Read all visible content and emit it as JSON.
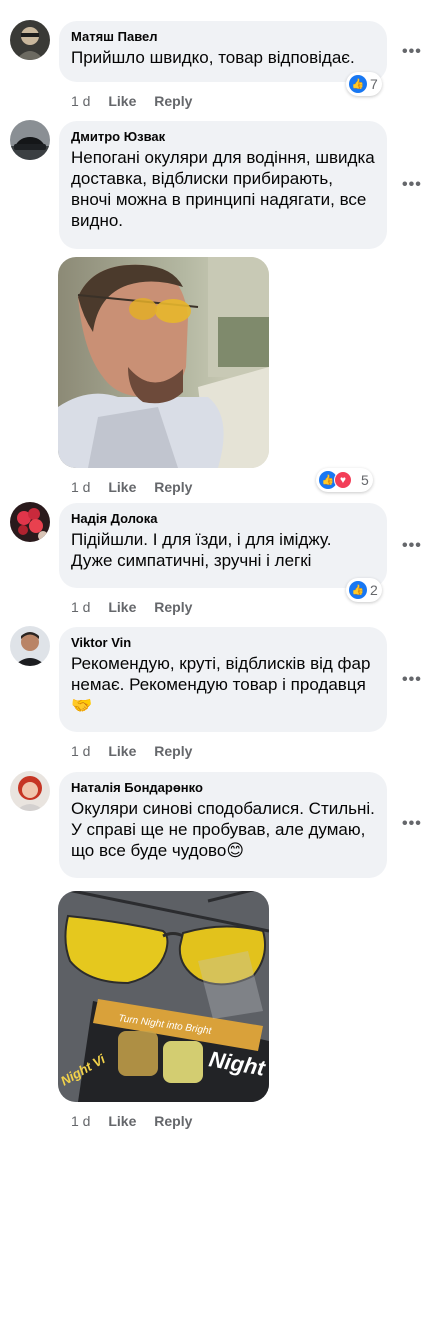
{
  "action_labels": {
    "like": "Like",
    "reply": "Reply"
  },
  "more_glyph": "•••",
  "comments": [
    {
      "name": "Матяш Павел",
      "text": "Прийшло швидко, товар відповідає.",
      "time": "1 d",
      "reactions": "7"
    },
    {
      "name": "Дмитро Юзвак",
      "text": "Непогані окуляри для водіння, швидка доставка, відблиски прибирають, вночі можна в принципі надягати, все видно.",
      "time": "1 d",
      "reactions": "5"
    },
    {
      "name": "Надія Долока",
      "text": "Підійшли. І для їзди, і для іміджу. Дуже симпатичні, зручні і легкі",
      "time": "1 d",
      "reactions": "2"
    },
    {
      "name": "Viktor Vin",
      "text": "Рекомендую, круті, відблисків від фар немає. Рекомендую товар і продавця🤝",
      "time": "1 d"
    },
    {
      "name": "Наталія Бондарөнко",
      "text": "Окуляри синові сподобалися. Стильні. У справі ще не пробував, але думаю, що все буде чудово😊",
      "time": "1 d"
    }
  ],
  "photo2_text": {
    "brand": "Night",
    "tagline": "Turn Night into Bright",
    "corner": "Night Vi"
  },
  "colors": {
    "bubble": "#f0f2f5",
    "like_blue": "#1877f2",
    "love_red": "#f33e58",
    "meta_gray": "#65676b"
  }
}
